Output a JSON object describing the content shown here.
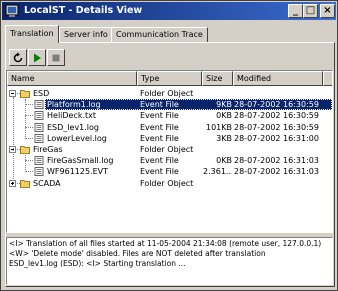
{
  "window": {
    "title": "LocalST - Details View",
    "controls": {
      "minimize": "_",
      "maximize": "□",
      "close": "×"
    }
  },
  "tabs": [
    {
      "label": "Translation",
      "active": true
    },
    {
      "label": "Server info",
      "active": false
    },
    {
      "label": "Communication Trace",
      "active": false
    }
  ],
  "toolbar": {
    "refresh_icon": "refresh-icon",
    "play_icon": "play-icon",
    "stop_icon": "stop-icon",
    "play_color": "#008000"
  },
  "list": {
    "columns": [
      "Name",
      "Type",
      "Size",
      "Modified"
    ],
    "rows": [
      {
        "name": "ESD",
        "type": "Folder Object",
        "size": "",
        "modified": "",
        "kind": "folder",
        "expanded": true
      },
      {
        "name": "Platform1.log",
        "type": "Event File",
        "size": "9KB",
        "modified": "28-07-2002 16:30:59",
        "kind": "file",
        "selected": true
      },
      {
        "name": "HeliDeck.txt",
        "type": "Event File",
        "size": "0KB",
        "modified": "28-07-2002 16:30:59",
        "kind": "file"
      },
      {
        "name": "ESD_lev1.log",
        "type": "Event File",
        "size": "101KB",
        "modified": "28-07-2002 16:30:59",
        "kind": "file"
      },
      {
        "name": "LowerLevel.log",
        "type": "Event File",
        "size": "3KB",
        "modified": "28-07-2002 16:31:00",
        "kind": "file"
      },
      {
        "name": "FireGas",
        "type": "Folder Object",
        "size": "",
        "modified": "",
        "kind": "folder",
        "expanded": true
      },
      {
        "name": "FireGasSmall.log",
        "type": "Event File",
        "size": "0KB",
        "modified": "28-07-2002 16:31:03",
        "kind": "file"
      },
      {
        "name": "WF961125.EVT",
        "type": "Event File",
        "size": "2.361...",
        "modified": "28-07-2002 16:31:03",
        "kind": "file"
      },
      {
        "name": "SCADA",
        "type": "Folder Object",
        "size": "",
        "modified": "",
        "kind": "folder",
        "expanded": false
      }
    ],
    "selection_color": "#0a246a",
    "folder_color": "#f0d060"
  },
  "log": {
    "lines": [
      "<I> Translation of all files started at 11-05-2004 21:34:08 (remote user, 127.0.0.1)",
      "<W> 'Delete mode' disabled. Files are NOT deleted after translation",
      "ESD_lev1.log (ESD): <I> Starting translation ..."
    ]
  }
}
